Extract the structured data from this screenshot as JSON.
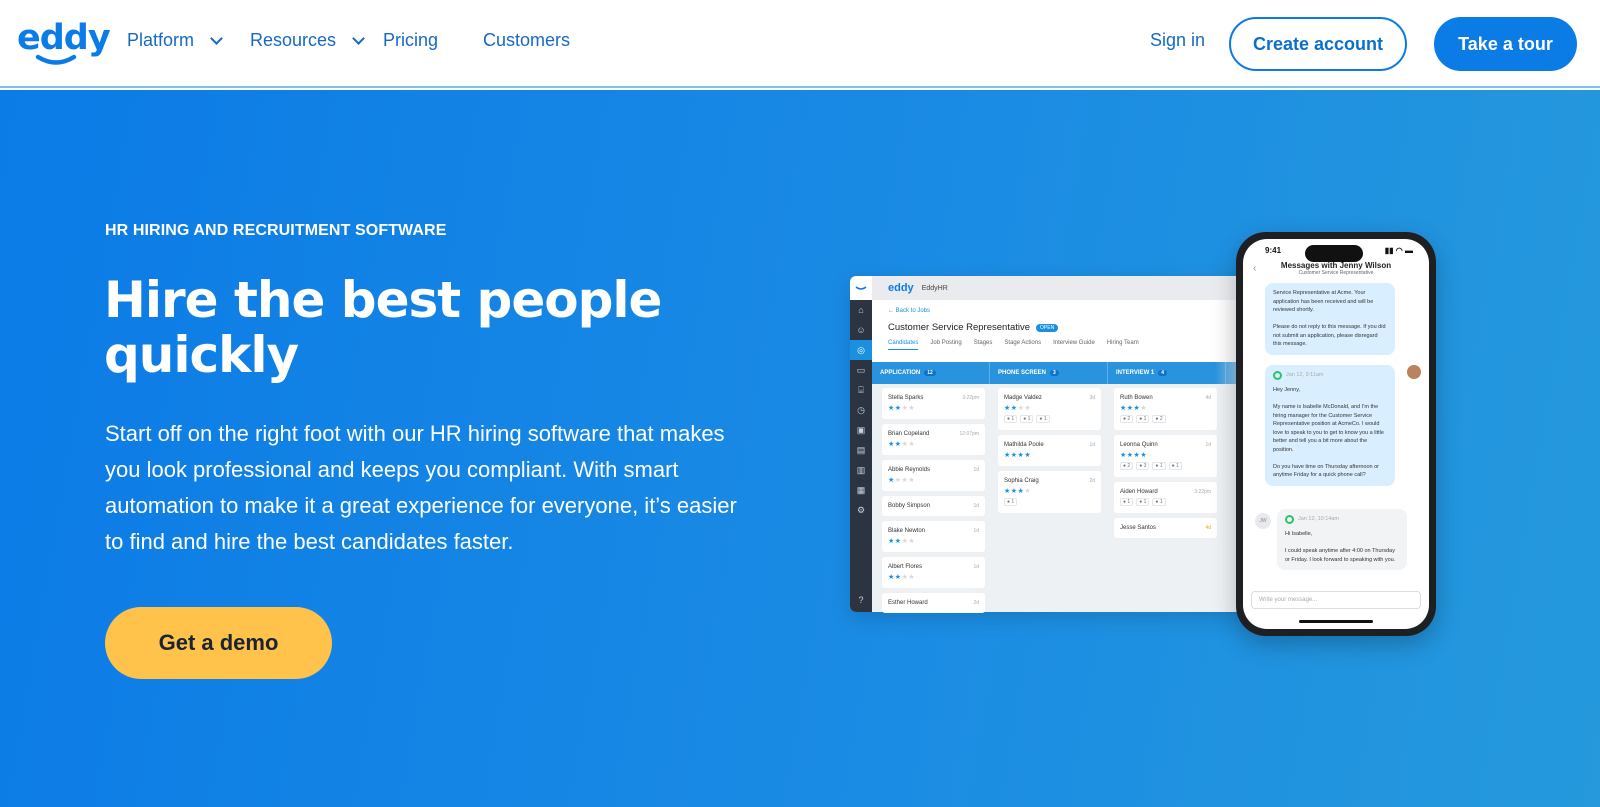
{
  "nav": {
    "logo": "eddy",
    "links": [
      {
        "label": "Platform",
        "has_dropdown": true
      },
      {
        "label": "Resources",
        "has_dropdown": true
      },
      {
        "label": "Pricing",
        "has_dropdown": false
      },
      {
        "label": "Customers",
        "has_dropdown": false
      }
    ],
    "sign_in": "Sign in",
    "create_account": "Create account",
    "take_tour": "Take a tour"
  },
  "hero": {
    "eyebrow": "HR HIRING AND RECRUITMENT SOFTWARE",
    "title": "Hire the best people quickly",
    "lead": "Start off on the right foot with our HR hiring software that makes you look professional and keeps you compliant. With smart automation to make it a great experience for everyone, it’s easier to find and hire the best candidates faster.",
    "cta": "Get a demo"
  },
  "colors": {
    "brand": "#0b7be6",
    "cta": "#ffc24b",
    "nav_text": "#1769c4"
  },
  "app": {
    "logo": "eddy",
    "org": "EddyHR",
    "back": "← Back to Jobs",
    "job_title": "Customer Service Representative",
    "status": "OPEN",
    "tabs": [
      "Candidates",
      "Job Posting",
      "Stages",
      "Stage Actions",
      "Interview Guide",
      "Hiring Team"
    ],
    "columns": [
      {
        "name": "APPLICATION",
        "count": "12"
      },
      {
        "name": "PHONE SCREEN",
        "count": "3"
      },
      {
        "name": "INTERVIEW 1",
        "count": "4"
      }
    ],
    "lanes": [
      [
        {
          "name": "Stella Sparks",
          "time": "3:22pm",
          "stars": 2
        },
        {
          "name": "Brian Copeland",
          "time": "12:07pm",
          "stars": 2
        },
        {
          "name": "Abbie Reynolds",
          "time": "1d",
          "stars": 1
        },
        {
          "name": "Bobby Simpson",
          "time": "1d",
          "stars": 0
        },
        {
          "name": "Blake Newton",
          "time": "1d",
          "stars": 2
        },
        {
          "name": "Albert Flores",
          "time": "1d",
          "stars": 2
        },
        {
          "name": "Esther Howard",
          "time": "2d",
          "stars": 0
        }
      ],
      [
        {
          "name": "Madge Valdez",
          "time": "3d",
          "stars": 2,
          "tags": [
            "1",
            "1",
            "1"
          ]
        },
        {
          "name": "Mathilda Poole",
          "time": "1d",
          "stars": 4
        },
        {
          "name": "Sophia Craig",
          "time": "2d",
          "stars": 3,
          "tags": [
            "1"
          ]
        }
      ],
      [
        {
          "name": "Ruth Bowen",
          "time": "4d",
          "stars": 3,
          "tags": [
            "2",
            "1",
            "2"
          ]
        },
        {
          "name": "Leonna Quinn",
          "time": "1d",
          "stars": 4,
          "tags": [
            "2",
            "3",
            "1",
            "1"
          ]
        },
        {
          "name": "Aiden Howard",
          "time": "3:22pm",
          "stars": 0,
          "tags": [
            "1",
            "1",
            "1"
          ]
        },
        {
          "name": "Jesse Santos",
          "time": "4d",
          "stars": 0,
          "warn": true
        }
      ]
    ]
  },
  "phone": {
    "time": "9:41",
    "title": "Messages with Jenny Wilson",
    "subtitle": "Customer Service Representative",
    "msg1": "Service Representative at Acme. Your application has been received and will be reviewed shortly.\n\nPlease do not reply to this message. If you did not submit an application, please disregard this message.",
    "msg2_meta": "Jan 12, 9:11am",
    "msg2": "Hey Jenny,\n\nMy name is Isabelle McDonald, and I’m the hiring manager for the Customer Service Representative position at AcmeCo. I would love to speak to you to get to know you a little better and tell you a bit more about the position.\n\nDo you have time on Thursday afternoon or anytime Friday for a quick phone call?",
    "reply_initials": "JW",
    "msg3_meta": "Jan 12, 10:14am",
    "msg3": "Hi Isabelle,\n\nI could speak anytime after 4:00 on Thursday or Friday. I look forward to speaking with you.",
    "input_placeholder": "Write your message..."
  }
}
